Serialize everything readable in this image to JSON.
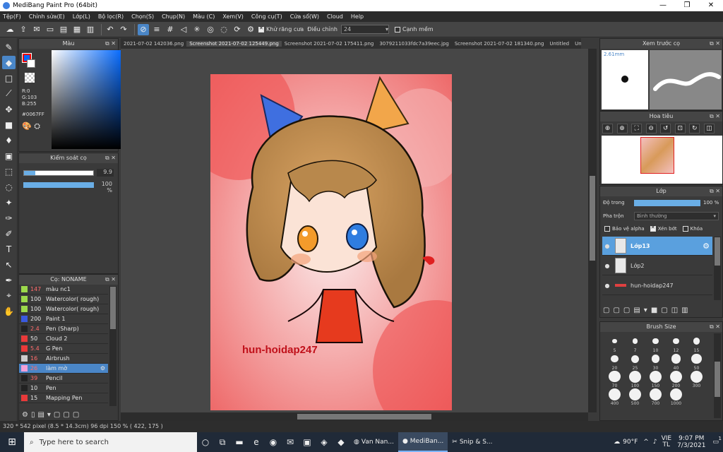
{
  "window": {
    "title": "MediBang Paint Pro (64bit)",
    "minimize": "—",
    "maximize": "❐",
    "close": "✕"
  },
  "menu": [
    "Tệp(F)",
    "Chỉnh sửa(E)",
    "Lớp(L)",
    "Bộ lọc(R)",
    "Chọn(S)",
    "Chụp(N)",
    "Màu (C)",
    "Xem(V)",
    "Công cụ(T)",
    "Cửa sổ(W)",
    "Cloud",
    "Help"
  ],
  "toolbar": {
    "antialias_label": "Khử răng cưa",
    "adjust_label": "Điều chỉnh",
    "adjust_value": "24",
    "smooth_label": "Cạnh mềm"
  },
  "color_panel": {
    "title": "Màu",
    "r": "R:0",
    "g": "G:103",
    "b": "B:255",
    "hex": "#0067FF",
    "primary": "#0067ff"
  },
  "brush_control": {
    "title": "Kiểm soát cọ",
    "size_value": "9.9",
    "size_fraction": 0.16,
    "opacity_value": "100 %",
    "opacity_fraction": 1.0
  },
  "brush_list": {
    "title": "Cọ: NONAME",
    "items": [
      {
        "size": "147",
        "name": "màu nc1",
        "color": "#9bd84b",
        "red": true
      },
      {
        "size": "100",
        "name": "Watercolor( rough)",
        "color": "#9bd84b",
        "red": false
      },
      {
        "size": "100",
        "name": "Watercolor( rough)",
        "color": "#9bd84b",
        "red": false
      },
      {
        "size": "200",
        "name": "Paint 1",
        "color": "#3a5ae0",
        "red": false
      },
      {
        "size": "2.4",
        "name": "Pen (Sharp)",
        "color": "#222222",
        "red": true
      },
      {
        "size": "50",
        "name": "Cloud 2",
        "color": "#e83a3a",
        "red": false
      },
      {
        "size": "5.4",
        "name": "G Pen",
        "color": "#e83a3a",
        "red": true
      },
      {
        "size": "16",
        "name": "Airbrush",
        "color": "#cccccc",
        "red": true
      },
      {
        "size": "26",
        "name": "làm mờ",
        "color": "#f2a0d8",
        "red": true
      },
      {
        "size": "39",
        "name": "Pencil",
        "color": "#222222",
        "red": true
      },
      {
        "size": "10",
        "name": "Pen",
        "color": "#222222",
        "red": false
      },
      {
        "size": "15",
        "name": "Mapping Pen",
        "color": "#e83a3a",
        "red": false
      }
    ],
    "selected_index": 8
  },
  "tabs": [
    "2021-07-02 142036.png",
    "Screenshot 2021-07-02 125449.png",
    "Screenshot 2021-07-02 175411.png",
    "3079211033fdc7a39eec.jpg",
    "Screenshot 2021-07-02 181340.png",
    "Untitled",
    "Untitled"
  ],
  "active_tab": 1,
  "canvas": {
    "watermark": "hun-hoidap247"
  },
  "preview_panel": {
    "title": "Xem trước cọ",
    "size": "2.61mm"
  },
  "navigator_panel": {
    "title": "Hoa tiêu"
  },
  "layer_panel": {
    "title": "Lớp",
    "opacity_label": "Độ trong",
    "opacity_value": "100 %",
    "blend_label": "Pha trộn",
    "blend_value": "Bình thường",
    "protect_alpha": "Bảo vệ alpha",
    "clipping": "Xén bớt",
    "lock": "Khóa",
    "layers": [
      {
        "name": "Lớp13",
        "selected": true
      },
      {
        "name": "Lớp2",
        "selected": false
      },
      {
        "name": "hun-hoidap247",
        "selected": false
      }
    ]
  },
  "brush_size": {
    "title": "Brush Size",
    "sizes": [
      "5",
      "7",
      "10",
      "12",
      "15",
      "20",
      "25",
      "30",
      "40",
      "50",
      "70",
      "100",
      "150",
      "200",
      "300",
      "400",
      "500",
      "700",
      "1000"
    ]
  },
  "status": "320 * 542 pixel  (8.5 * 14.3cm)  96 dpi  150 %  ( 422, 175 )",
  "taskbar": {
    "search_placeholder": "Type here to search",
    "apps": [
      {
        "name": "Van Nan..."
      },
      {
        "name": "MediBan..."
      },
      {
        "name": "Snip & S..."
      }
    ],
    "weather": "90°F",
    "lang": "VIE",
    "lang2": "TL",
    "time": "9:07 PM",
    "date": "7/3/2021",
    "notifications": "1"
  }
}
